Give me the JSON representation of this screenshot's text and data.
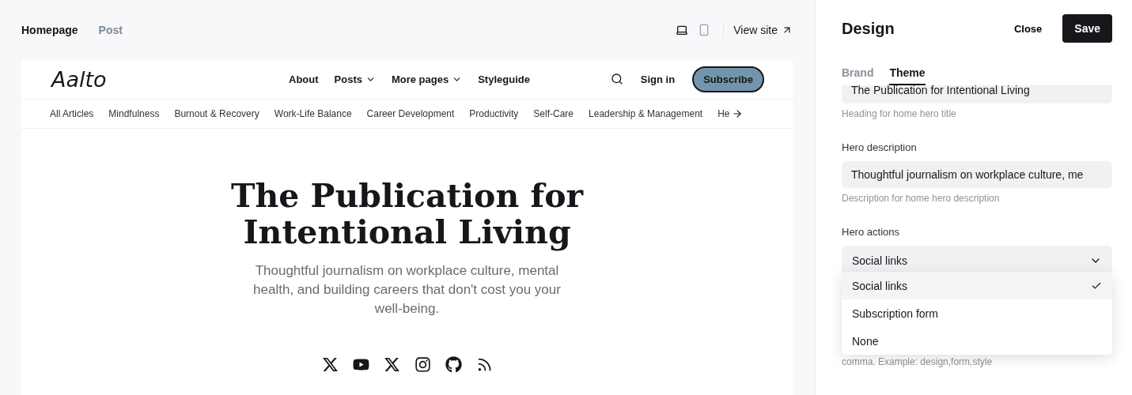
{
  "editor_tabs": [
    {
      "label": "Homepage",
      "selected": true
    },
    {
      "label": "Post",
      "selected": false
    }
  ],
  "devices": [
    {
      "kind": "desktop",
      "selected": true
    },
    {
      "kind": "mobile",
      "selected": false
    }
  ],
  "view_site": "View site",
  "preview": {
    "logo": "Aalto",
    "nav": [
      {
        "label": "About",
        "dropdown": false
      },
      {
        "label": "Posts",
        "dropdown": true
      },
      {
        "label": "More pages",
        "dropdown": true
      },
      {
        "label": "Styleguide",
        "dropdown": false
      }
    ],
    "sign_in": "Sign in",
    "subscribe": "Subscribe",
    "categories": [
      "All Articles",
      "Mindfulness",
      "Burnout & Recovery",
      "Work-Life Balance",
      "Career Development",
      "Productivity",
      "Self-Care",
      "Leadership & Management",
      "He"
    ],
    "hero_title": "The Publication for Intentional Living",
    "hero_description": "Thoughtful journalism on workplace culture, mental health, and building careers that don't cost you your well-being.",
    "social_links": [
      {
        "kind": "x"
      },
      {
        "kind": "youtube"
      },
      {
        "kind": "x"
      },
      {
        "kind": "instagram"
      },
      {
        "kind": "github"
      },
      {
        "kind": "rss"
      }
    ]
  },
  "panel": {
    "title": "Design",
    "close": "Close",
    "save": "Save",
    "tabs": [
      {
        "label": "Brand",
        "selected": false
      },
      {
        "label": "Theme",
        "selected": true
      }
    ],
    "hero_title_field": {
      "value": "The Publication for Intentional Living",
      "hint": "Heading for home hero title"
    },
    "hero_description_field": {
      "label": "Hero description",
      "value": "Thoughtful journalism on workplace culture, me",
      "hint": "Description for home hero description"
    },
    "hero_actions": {
      "label": "Hero actions",
      "value": "Social links",
      "options": [
        {
          "label": "Social links",
          "selected": true
        },
        {
          "label": "Subscription form",
          "selected": false
        },
        {
          "label": "None",
          "selected": false
        }
      ]
    },
    "hidden_hint": "comma. Example: design,form,style"
  }
}
